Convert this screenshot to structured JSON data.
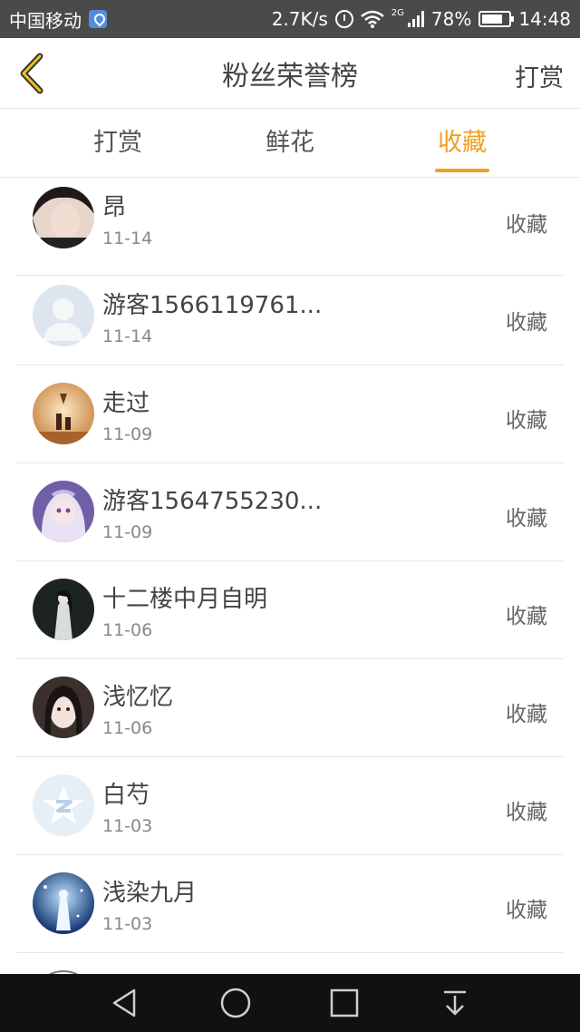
{
  "status_bar": {
    "carrier": "中国移动",
    "speed": "2.7K/s",
    "network": "2G",
    "battery": "78%",
    "time": "14:48"
  },
  "header": {
    "title": "粉丝荣誉榜",
    "action_label": "打赏",
    "accent_color": "#f0a020"
  },
  "tabs": [
    {
      "label": "打赏",
      "active": false
    },
    {
      "label": "鲜花",
      "active": false
    },
    {
      "label": "收藏",
      "active": true
    }
  ],
  "list": {
    "items": [
      {
        "name": "昂",
        "date": "11-14",
        "action": "收藏",
        "avatar": "photo-dark-hair"
      },
      {
        "name": "游客1566119761...",
        "date": "11-14",
        "action": "收藏",
        "avatar": "default-user"
      },
      {
        "name": "走过",
        "date": "11-09",
        "action": "收藏",
        "avatar": "sunset-scene"
      },
      {
        "name": "游客1564755230...",
        "date": "11-09",
        "action": "收藏",
        "avatar": "anime-purple"
      },
      {
        "name": "十二楼中月自明",
        "date": "11-06",
        "action": "收藏",
        "avatar": "dark-figure"
      },
      {
        "name": "浅忆忆",
        "date": "11-06",
        "action": "收藏",
        "avatar": "photo-girl"
      },
      {
        "name": "白芍",
        "date": "11-03",
        "action": "收藏",
        "avatar": "qzone-logo"
      },
      {
        "name": "浅染九月",
        "date": "11-03",
        "action": "收藏",
        "avatar": "blue-fantasy"
      }
    ]
  },
  "nav_bar": {
    "buttons": [
      "back-icon",
      "home-icon",
      "recents-icon",
      "notification-pull-icon"
    ]
  }
}
